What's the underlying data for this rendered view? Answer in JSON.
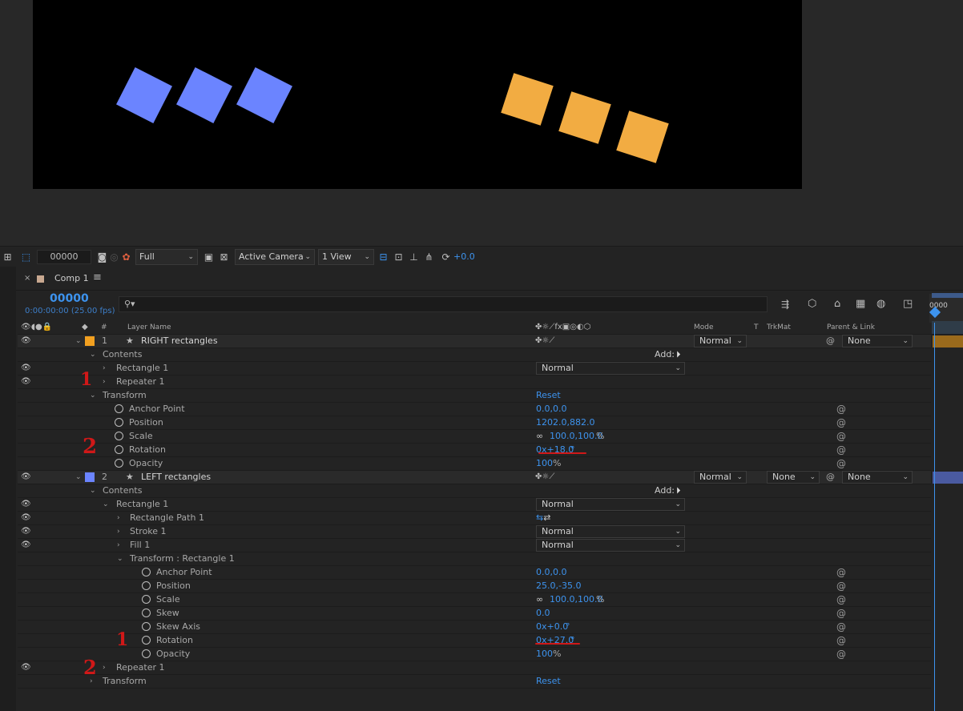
{
  "viewer": {
    "background": "#000000"
  },
  "toolbar": {
    "timecode": "00000",
    "resolution": "Full",
    "camera": "Active Camera",
    "views": "1 View",
    "exposure": "+0.0"
  },
  "timeline": {
    "comp_tab": "Comp 1",
    "timecode": "00000",
    "timecode_sub": "0:00:00:00 (25.00 fps)",
    "search_placeholder": "",
    "ruler_label": "0000",
    "columns": {
      "hash": "#",
      "layer_name": "Layer Name",
      "mode": "Mode",
      "t": "T",
      "trkmat": "TrkMat",
      "parent": "Parent & Link"
    }
  },
  "rows": {
    "l1_index": "1",
    "l1_name": "RIGHT rectangles",
    "l1_mode": "Normal",
    "l1_parent": "None",
    "contents": "Contents",
    "add": "Add:",
    "rect1": "Rectangle 1",
    "rect1_mode": "Normal",
    "repeater1": "Repeater 1",
    "transform": "Transform",
    "reset": "Reset",
    "anchor": "Anchor Point",
    "anchor_val": "0.0,0.0",
    "position": "Position",
    "position_val": "1202.0,882.0",
    "scale": "Scale",
    "scale_val": "100.0,100.0",
    "scale_unit": "%",
    "rotation": "Rotation",
    "rotation_val": "0x+18.0",
    "deg": "°",
    "opacity": "Opacity",
    "opacity_val": "100",
    "pct": "%",
    "l2_index": "2",
    "l2_name": "LEFT rectangles",
    "l2_mode": "Normal",
    "l2_trkmat": "None",
    "l2_parent": "None",
    "l2_contents": "Contents",
    "l2_rect1": "Rectangle 1",
    "l2_rect1_mode": "Normal",
    "rect_path": "Rectangle Path 1",
    "stroke": "Stroke 1",
    "stroke_mode": "Normal",
    "fill": "Fill 1",
    "fill_mode": "Normal",
    "tr_rect": "Transform : Rectangle 1",
    "t_anchor": "Anchor Point",
    "t_anchor_val": "0.0,0.0",
    "t_position": "Position",
    "t_position_val": "25.0,-35.0",
    "t_scale": "Scale",
    "t_scale_val": "100.0,100.0",
    "t_skew": "Skew",
    "t_skew_val": "0.0",
    "t_skewaxis": "Skew Axis",
    "t_skewaxis_val": "0x+0.0",
    "t_rotation": "Rotation",
    "t_rotation_val": "0x+27.0",
    "t_opacity": "Opacity",
    "t_opacity_val": "100",
    "l2_repeater": "Repeater 1",
    "l2_transform": "Transform",
    "l2_reset": "Reset"
  },
  "annotations": {
    "a1": "1",
    "a2": "2",
    "a3": "1",
    "a4": "2"
  },
  "colors": {
    "orange": "#f2ac42",
    "blue": "#6b84ff",
    "accent": "#3d93ee",
    "annotation": "#d01818"
  }
}
